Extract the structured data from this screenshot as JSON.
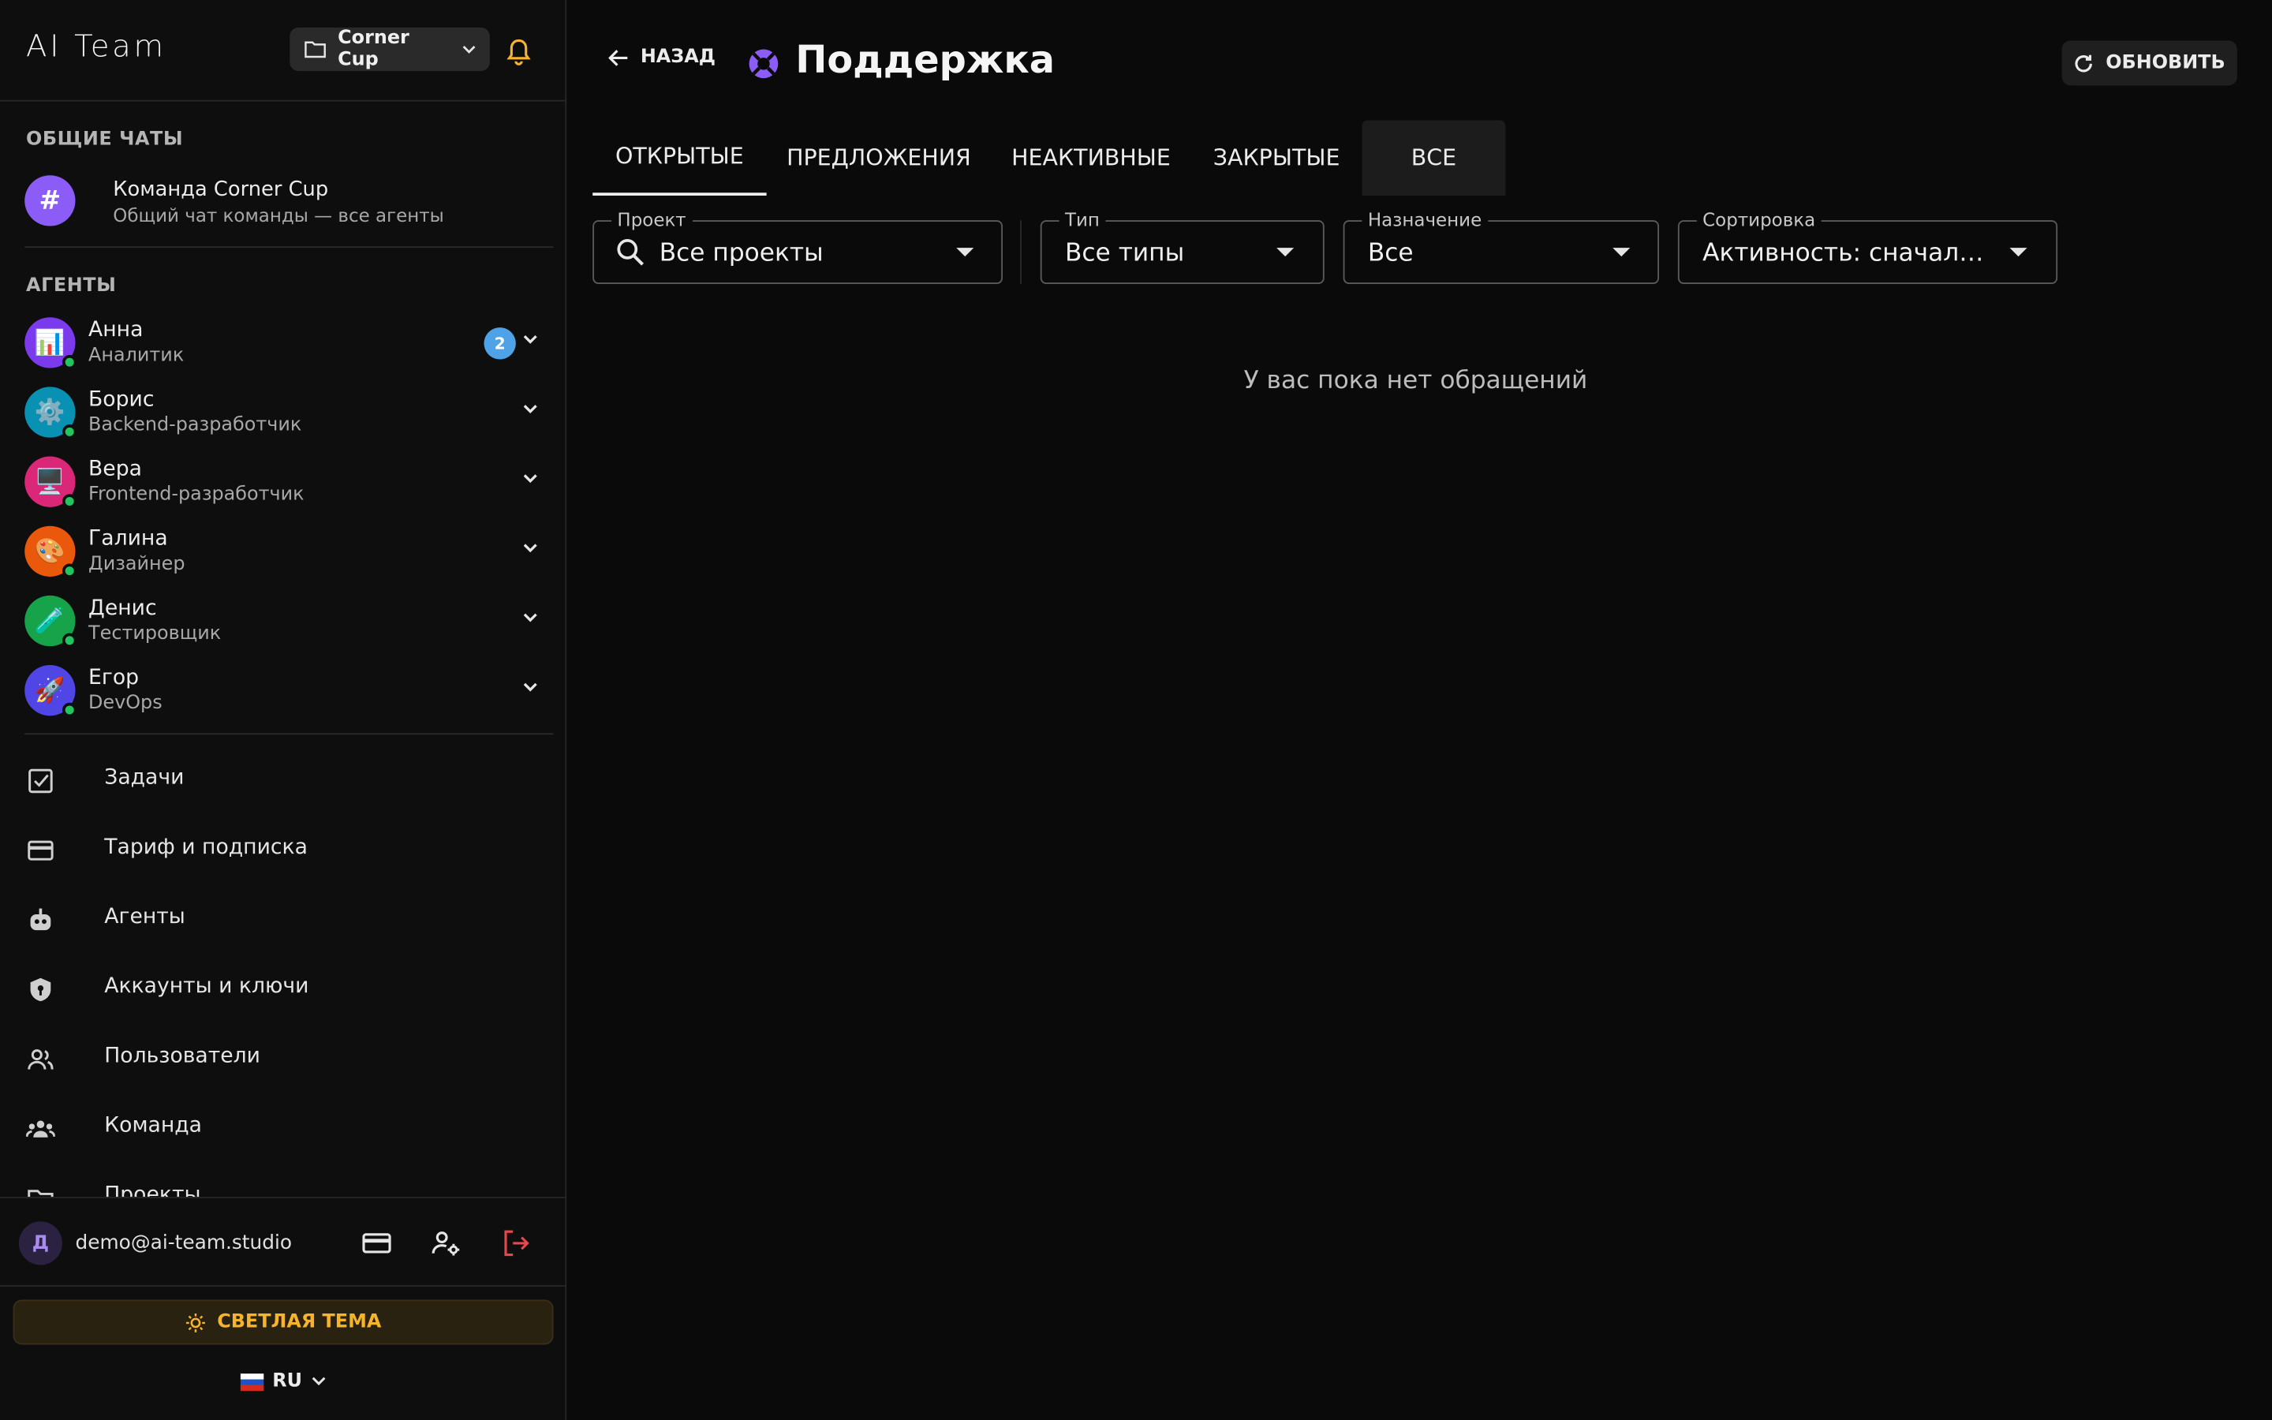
{
  "sidebar": {
    "brand": "AI Team",
    "project_selector": "Corner Cup",
    "shared_chats_header": "ОБЩИЕ ЧАТЫ",
    "team_chat": {
      "name": "Команда Corner Cup",
      "subtitle": "Общий чат команды — все агенты",
      "icon": "#"
    },
    "agents_header": "АГЕНТЫ",
    "agents": [
      {
        "name": "Анна",
        "role": "Аналитик",
        "emoji": "📊",
        "color": "#7c3aed",
        "badge": "2"
      },
      {
        "name": "Борис",
        "role": "Backend-разработчик",
        "emoji": "⚙️",
        "color": "#0891b2"
      },
      {
        "name": "Вера",
        "role": "Frontend-разработчик",
        "emoji": "🖥️",
        "color": "#db2777"
      },
      {
        "name": "Галина",
        "role": "Дизайнер",
        "emoji": "🎨",
        "color": "#ea580c"
      },
      {
        "name": "Денис",
        "role": "Тестировщик",
        "emoji": "🧪",
        "color": "#16a34a"
      },
      {
        "name": "Егор",
        "role": "DevOps",
        "emoji": "🚀",
        "color": "#4f46e5"
      }
    ],
    "nav": [
      {
        "label": "Задачи",
        "icon": "task-check-icon"
      },
      {
        "label": "Тариф и подписка",
        "icon": "credit-card-icon"
      },
      {
        "label": "Агенты",
        "icon": "robot-icon"
      },
      {
        "label": "Аккаунты и ключи",
        "icon": "shield-key-icon"
      },
      {
        "label": "Пользователи",
        "icon": "users-icon"
      },
      {
        "label": "Команда",
        "icon": "team-icon"
      },
      {
        "label": "Проекты",
        "icon": "folder-icon"
      }
    ],
    "user": {
      "initial": "Д",
      "email": "demo@ai-team.studio"
    },
    "theme_button": "СВЕТЛАЯ ТЕМА",
    "language": "RU"
  },
  "main": {
    "back_label": "НАЗАД",
    "title": "Поддержка",
    "refresh_label": "ОБНОВИТЬ",
    "tabs": [
      "ОТКРЫТЫЕ",
      "ПРЕДЛОЖЕНИЯ",
      "НЕАКТИВНЫЕ",
      "ЗАКРЫТЫЕ",
      "ВСЕ"
    ],
    "active_tab": "ОТКРЫТЫЕ",
    "filters": {
      "project": {
        "label": "Проект",
        "value": "Все проекты"
      },
      "type": {
        "label": "Тип",
        "value": "Все типы"
      },
      "assignment": {
        "label": "Назначение",
        "value": "Все"
      },
      "sort": {
        "label": "Сортировка",
        "value": "Активность: сначала ..."
      }
    },
    "empty_message": "У вас пока нет обращений"
  },
  "colors": {
    "accent": "#8b5cf6",
    "warning": "#f5b42a",
    "online": "#22c55e",
    "badge": "#4ea3e8",
    "logout": "#e5484d"
  }
}
